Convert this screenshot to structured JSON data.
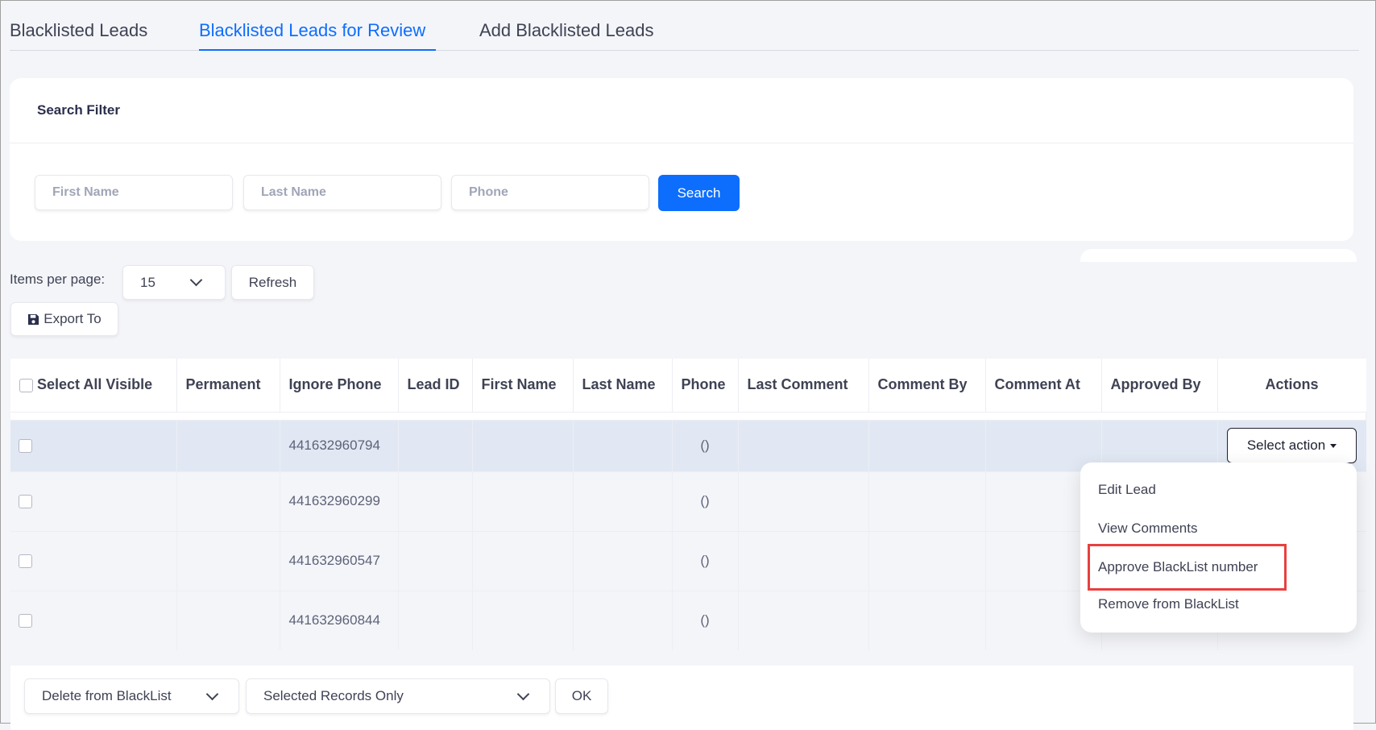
{
  "tabs": [
    {
      "label": "Blacklisted Leads",
      "active": false
    },
    {
      "label": "Blacklisted Leads for Review",
      "active": true
    },
    {
      "label": "Add Blacklisted Leads",
      "active": false
    }
  ],
  "filter": {
    "title": "Search Filter",
    "first_name_placeholder": "First Name",
    "last_name_placeholder": "Last Name",
    "phone_placeholder": "Phone",
    "search_label": "Search"
  },
  "controls": {
    "items_per_page_label": "Items per page:",
    "items_per_page_value": "15",
    "refresh_label": "Refresh",
    "export_label": "Export To"
  },
  "table": {
    "columns": [
      "Select All Visible",
      "Permanent",
      "Ignore Phone",
      "Lead ID",
      "First Name",
      "Last Name",
      "Phone",
      "Last Comment",
      "Comment By",
      "Comment At",
      "Approved By",
      "Actions"
    ],
    "rows": [
      {
        "ignore_phone": "441632960794",
        "phone": "()"
      },
      {
        "ignore_phone": "441632960299",
        "phone": "()"
      },
      {
        "ignore_phone": "441632960547",
        "phone": "()"
      },
      {
        "ignore_phone": "441632960844",
        "phone": "()"
      }
    ],
    "action_button": "Select action"
  },
  "action_menu": {
    "items": [
      "Edit Lead",
      "View Comments",
      "Approve BlackList number",
      "Remove from BlackList"
    ],
    "highlighted": "Approve BlackList number"
  },
  "bulk": {
    "action_value": "Delete from BlackList",
    "scope_value": "Selected Records Only",
    "ok_label": "OK"
  },
  "colors": {
    "accent": "#0d6efd",
    "highlight": "#e8403f"
  }
}
